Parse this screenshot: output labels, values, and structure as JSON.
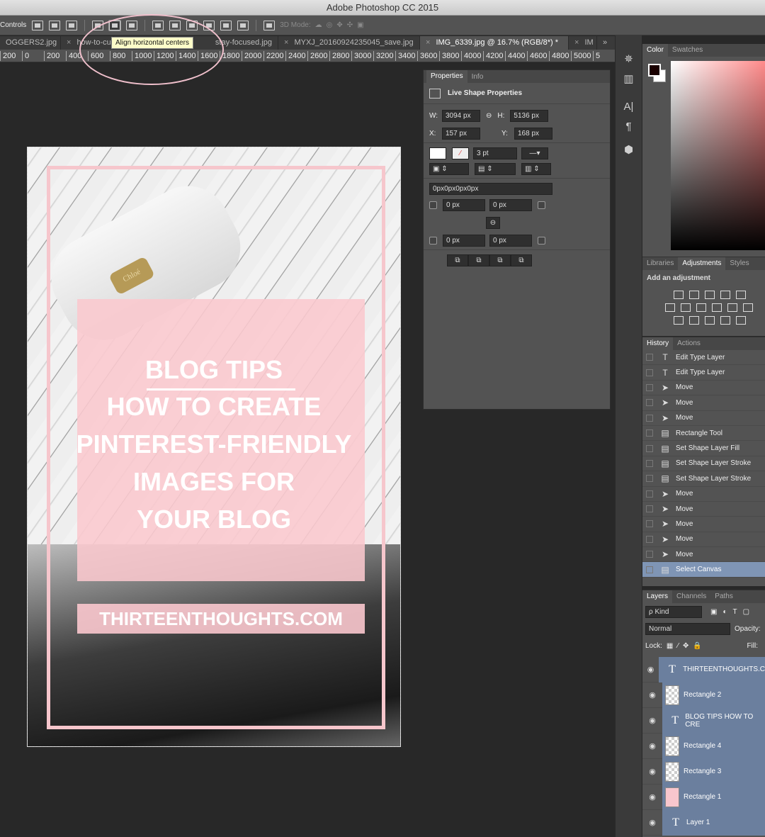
{
  "app": {
    "title": "Adobe Photoshop CC 2015"
  },
  "options": {
    "controls_label": "Controls",
    "mode_label": "3D Mode:"
  },
  "tabs": [
    {
      "label": "OGGERS2.jpg"
    },
    {
      "label": "how-to-cu"
    },
    {
      "label": "stay-focused.jpg"
    },
    {
      "label": "MYXJ_20160924235045_save.jpg"
    },
    {
      "label": "IMG_6339.jpg @ 16.7% (RGB/8*) *",
      "active": true
    },
    {
      "label": "IM"
    }
  ],
  "ruler": [
    "200",
    "0",
    "200",
    "400",
    "600",
    "800",
    "1000",
    "1200",
    "1400",
    "1600",
    "1800",
    "2000",
    "2200",
    "2400",
    "2600",
    "2800",
    "3000",
    "3200",
    "3400",
    "3600",
    "3800",
    "4000",
    "4200",
    "4400",
    "4600",
    "4800",
    "5000",
    "5"
  ],
  "tooltip": "Align horizontal centers",
  "canvas": {
    "brand_tag": "Chloé",
    "lines": [
      "BLOG TIPS",
      "HOW TO CREATE",
      "PINTEREST-FRIENDLY",
      "IMAGES FOR",
      "YOUR BLOG"
    ],
    "url": "THIRTEENTHOUGHTS.COM",
    "frame_color": "#f6c6cc",
    "box_color": "#fbc8ce"
  },
  "properties": {
    "tab_properties": "Properties",
    "tab_info": "Info",
    "header": "Live Shape Properties",
    "w_label": "W:",
    "w": "3094 px",
    "h_label": "H:",
    "h": "5136 px",
    "x_label": "X:",
    "x": "157 px",
    "y_label": "Y:",
    "y": "168 px",
    "stroke": "3 pt",
    "radius_combined": "0px0px0px0px",
    "r1": "0 px",
    "r2": "0 px",
    "r3": "0 px",
    "r4": "0 px"
  },
  "color_panel": {
    "tab_color": "Color",
    "tab_swatches": "Swatches"
  },
  "adjustments": {
    "tab_libraries": "Libraries",
    "tab_adjustments": "Adjustments",
    "tab_styles": "Styles",
    "heading": "Add an adjustment"
  },
  "history": {
    "tab_history": "History",
    "tab_actions": "Actions",
    "items": [
      {
        "icon": "T",
        "label": "Edit Type Layer"
      },
      {
        "icon": "T",
        "label": "Edit Type Layer"
      },
      {
        "icon": "➤",
        "label": "Move"
      },
      {
        "icon": "➤",
        "label": "Move"
      },
      {
        "icon": "➤",
        "label": "Move"
      },
      {
        "icon": "▤",
        "label": "Rectangle Tool"
      },
      {
        "icon": "▤",
        "label": "Set Shape Layer Fill"
      },
      {
        "icon": "▤",
        "label": "Set Shape Layer Stroke"
      },
      {
        "icon": "▤",
        "label": "Set Shape Layer Stroke"
      },
      {
        "icon": "➤",
        "label": "Move"
      },
      {
        "icon": "➤",
        "label": "Move"
      },
      {
        "icon": "➤",
        "label": "Move"
      },
      {
        "icon": "➤",
        "label": "Move"
      },
      {
        "icon": "➤",
        "label": "Move"
      },
      {
        "icon": "▤",
        "label": "Select Canvas",
        "selected": true
      }
    ]
  },
  "layers": {
    "tab_layers": "Layers",
    "tab_channels": "Channels",
    "tab_paths": "Paths",
    "kind": "ρ Kind",
    "blend": "Normal",
    "opacity_label": "Opacity:",
    "lock_label": "Lock:",
    "fill_label": "Fill:",
    "items": [
      {
        "type": "text",
        "name": "THIRTEENTHOUGHTS.C"
      },
      {
        "type": "shape",
        "name": "Rectangle 2"
      },
      {
        "type": "text",
        "name": "BLOG TIPS HOW TO CRE"
      },
      {
        "type": "shape",
        "name": "Rectangle 4"
      },
      {
        "type": "shape",
        "name": "Rectangle 3"
      },
      {
        "type": "shape-pink",
        "name": "Rectangle 1"
      },
      {
        "type": "text",
        "name": "Layer 1"
      }
    ]
  }
}
